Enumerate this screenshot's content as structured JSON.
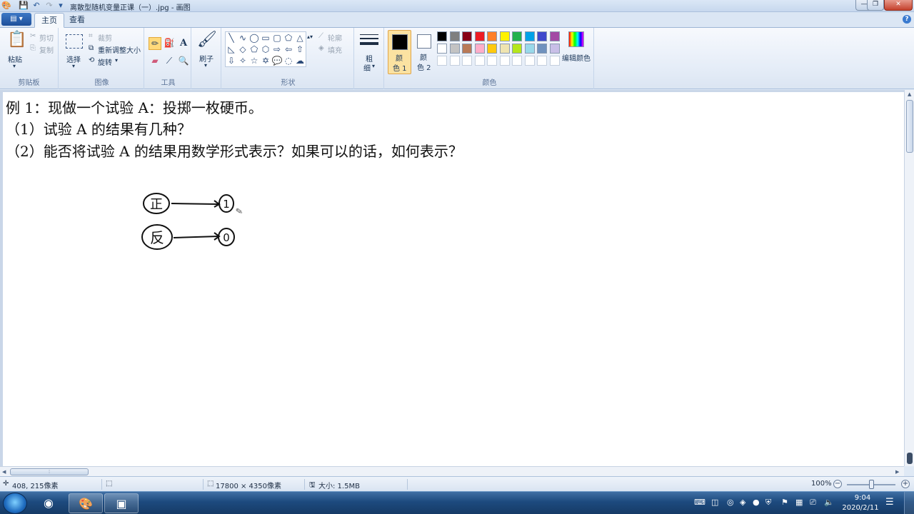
{
  "window": {
    "title": "离散型随机变量正课（一）.jpg - 画图",
    "app_menu_label": "▤ ▾"
  },
  "tabs": [
    {
      "label": "主页",
      "active": true
    },
    {
      "label": "查看",
      "active": false
    }
  ],
  "ribbon": {
    "clipboard": {
      "paste": "粘贴",
      "cut": "剪切",
      "copy": "复制",
      "group": "剪贴板"
    },
    "image": {
      "select": "选择",
      "crop": "裁剪",
      "resize": "重新调整大小",
      "rotate": "旋转",
      "group": "图像"
    },
    "tools": {
      "group": "工具"
    },
    "brushes": {
      "label": "刷子"
    },
    "shapes": {
      "outline": "轮廓",
      "fill": "填充",
      "group": "形状"
    },
    "size": {
      "label1": "粗",
      "label2": "细"
    },
    "colors": {
      "color1_label1": "颜",
      "color1_label2": "色 1",
      "color2_label1": "颜",
      "color2_label2": "色 2",
      "edit_colors": "编辑颜色",
      "group": "颜色",
      "color1": "#000000",
      "color2": "#ffffff",
      "palette_row1": [
        "#000000",
        "#7f7f7f",
        "#880015",
        "#ed1c24",
        "#ff7f27",
        "#fff200",
        "#22b14c",
        "#00a2e8",
        "#3f48cc",
        "#a349a4"
      ],
      "palette_row2": [
        "#ffffff",
        "#c3c3c3",
        "#b97a57",
        "#ffaec9",
        "#ffc90e",
        "#efe4b0",
        "#b5e61d",
        "#99d9ea",
        "#7092be",
        "#c8bfe7"
      ]
    }
  },
  "canvas": {
    "lines": [
      "例 1：现做一个试验 A：投掷一枚硬币。",
      "（1）试验 A 的结果有几种？",
      "（2）能否将试验 A 的结果用数学形式表示？如果可以的话，如何表示？"
    ],
    "diagram": [
      {
        "from": "正",
        "to": "1"
      },
      {
        "from": "反",
        "to": "0"
      }
    ]
  },
  "status": {
    "cursor_pos": "408, 215像素",
    "dimensions": "17800 × 4350像素",
    "file_size": "大小: 1.5MB",
    "zoom": "100%"
  },
  "taskbar": {
    "time": "9:04",
    "date": "2020/2/11"
  },
  "icons": {
    "paste": "clipboard-icon",
    "brush": "brush-icon",
    "pencil_cursor": "pencil-icon"
  }
}
